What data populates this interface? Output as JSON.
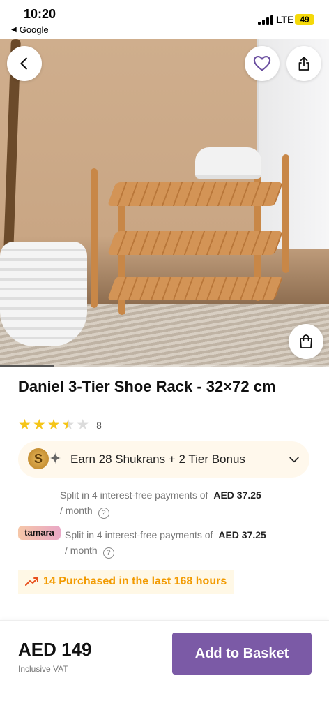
{
  "status_bar": {
    "time": "10:20",
    "back_app": "Google",
    "network": "LTE",
    "battery": "49"
  },
  "hero": {
    "icons": [
      "back-icon",
      "heart-icon",
      "share-icon",
      "shopping-bag-icon"
    ]
  },
  "product": {
    "title": "Daniel 3-Tier Shoe Rack - 32×72 cm",
    "rating": 3.5,
    "rating_max": 5,
    "rating_count": "8"
  },
  "shukran": {
    "coin_letter": "S",
    "text": "Earn 28 Shukrans + 2 Tier Bonus"
  },
  "installments": [
    {
      "text": "Split in 4 interest-free payments of",
      "amount": "AED 37.25",
      "period": "/ month"
    },
    {
      "provider": "tamara",
      "text": "Split in 4 interest-free payments of",
      "amount": "AED 37.25",
      "period": "/ month"
    }
  ],
  "purchased": {
    "text": "14 Purchased in the last 168 hours"
  },
  "footer": {
    "price": "AED 149",
    "vat_note": "Inclusive VAT",
    "cta": "Add to Basket"
  },
  "colors": {
    "cta": "#7b5aa6",
    "star": "#f5c518",
    "purchased": "#f29a00",
    "shukran_bg": "#fff8ec"
  }
}
